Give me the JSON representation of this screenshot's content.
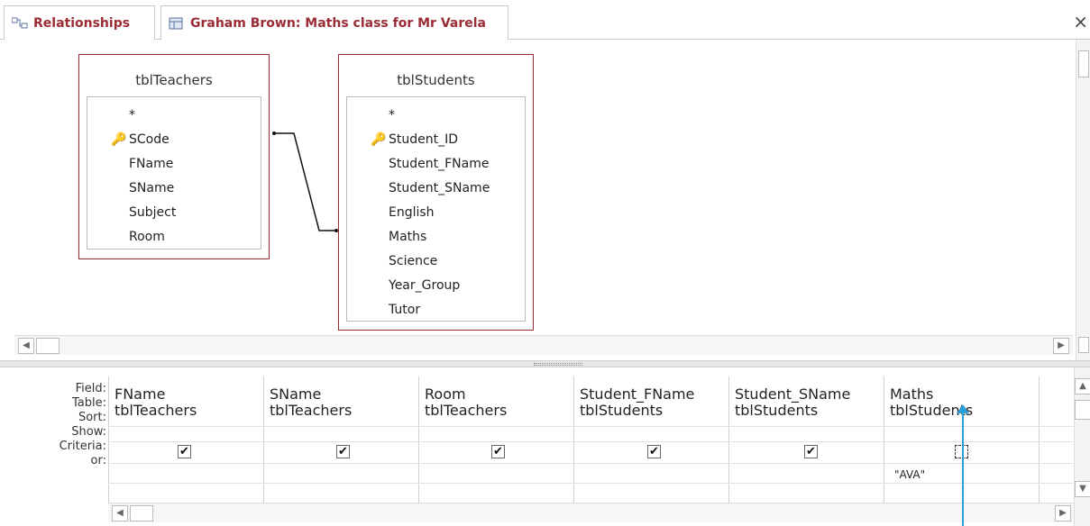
{
  "tabs": [
    {
      "label": "Relationships",
      "icon": "relationships-icon"
    },
    {
      "label": "Graham Brown: Maths class for Mr Varela",
      "icon": "query-icon"
    }
  ],
  "close_label": "×",
  "tables": [
    {
      "name": "tblTeachers",
      "fields": [
        "*",
        "SCode",
        "FName",
        "SName",
        "Subject",
        "Room"
      ],
      "key_field": "SCode"
    },
    {
      "name": "tblStudents",
      "fields": [
        "*",
        "Student_ID",
        "Student_FName",
        "Student_SName",
        "English",
        "Maths",
        "Science",
        "Year_Group",
        "Tutor"
      ],
      "key_field": "Student_ID"
    }
  ],
  "grid": {
    "row_labels": [
      "Field:",
      "Table:",
      "Sort:",
      "Show:",
      "Criteria:",
      "or:"
    ],
    "columns": [
      {
        "field": "FName",
        "table": "tblTeachers",
        "show": true,
        "criteria": ""
      },
      {
        "field": "SName",
        "table": "tblTeachers",
        "show": true,
        "criteria": ""
      },
      {
        "field": "Room",
        "table": "tblTeachers",
        "show": true,
        "criteria": ""
      },
      {
        "field": "Student_FName",
        "table": "tblStudents",
        "show": true,
        "criteria": ""
      },
      {
        "field": "Student_SName",
        "table": "tblStudents",
        "show": true,
        "criteria": ""
      },
      {
        "field": "Maths",
        "table": "tblStudents",
        "show": false,
        "criteria": "\"AVA\""
      }
    ]
  },
  "colors": {
    "accent": "#9b2b35",
    "arrow": "#2aa0d8"
  }
}
